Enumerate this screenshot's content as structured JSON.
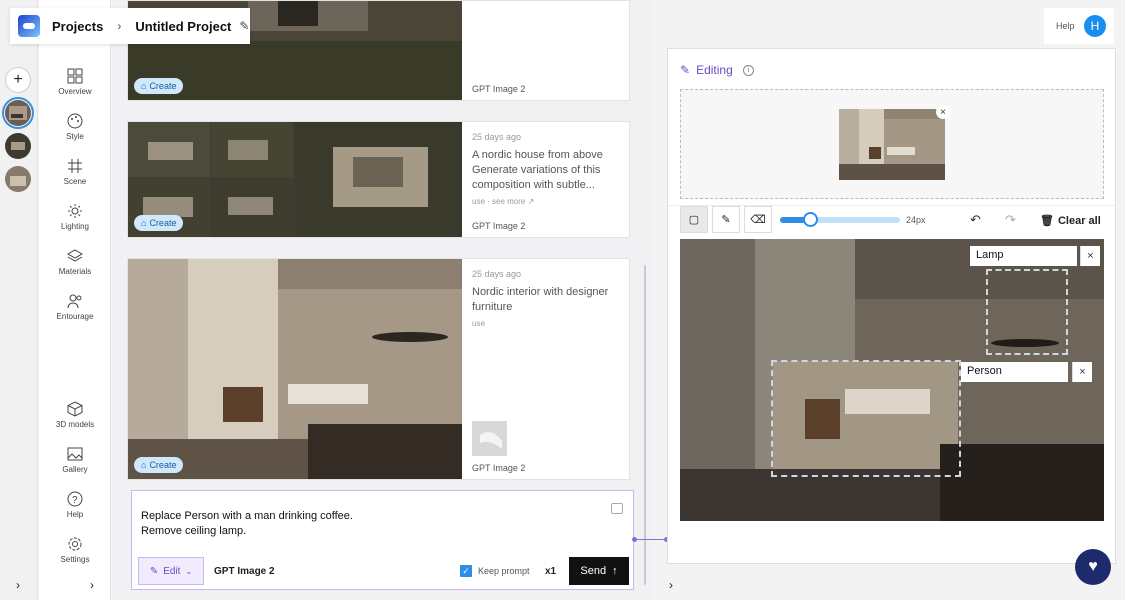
{
  "breadcrumb": {
    "root": "Projects",
    "project": "Untitled Project"
  },
  "help": {
    "label": "Help",
    "avatar": "H"
  },
  "nav": [
    {
      "label": "Overview",
      "icon": "grid-icon"
    },
    {
      "label": "Style",
      "icon": "palette-icon"
    },
    {
      "label": "Scene",
      "icon": "hash-icon"
    },
    {
      "label": "Lighting",
      "icon": "sun-icon"
    },
    {
      "label": "Materials",
      "icon": "layers-icon"
    },
    {
      "label": "Entourage",
      "icon": "people-icon"
    },
    {
      "label": "3D models",
      "icon": "cube-icon"
    },
    {
      "label": "Gallery",
      "icon": "image-icon"
    },
    {
      "label": "Help",
      "icon": "question-icon"
    },
    {
      "label": "Settings",
      "icon": "gear-icon"
    }
  ],
  "cards": [
    {
      "create": "Create",
      "model": "GPT Image 2"
    },
    {
      "date": "25 days ago",
      "prompt": "A nordic house from above Generate variations of this composition with subtle...",
      "use": "use",
      "see_more": "see more ↗",
      "create": "Create",
      "model": "GPT Image 2"
    },
    {
      "date": "25 days ago",
      "prompt": "Nordic interior with designer furniture",
      "use": "use",
      "create": "Create",
      "model": "GPT Image 2"
    }
  ],
  "prompt_box": {
    "line1": "Replace Person with a man drinking coffee.",
    "line2": "Remove ceiling lamp.",
    "mode": "Edit",
    "model": "GPT Image 2",
    "keep_prompt": "Keep prompt",
    "count": "x1",
    "send": "Send"
  },
  "editor": {
    "title": "Editing",
    "brush_size": "24px",
    "clear_all": "Clear all",
    "regions": [
      {
        "label": "Lamp"
      },
      {
        "label": "Person"
      }
    ]
  },
  "colors": {
    "accent": "#6a4bc4",
    "blue": "#2e8de6"
  }
}
